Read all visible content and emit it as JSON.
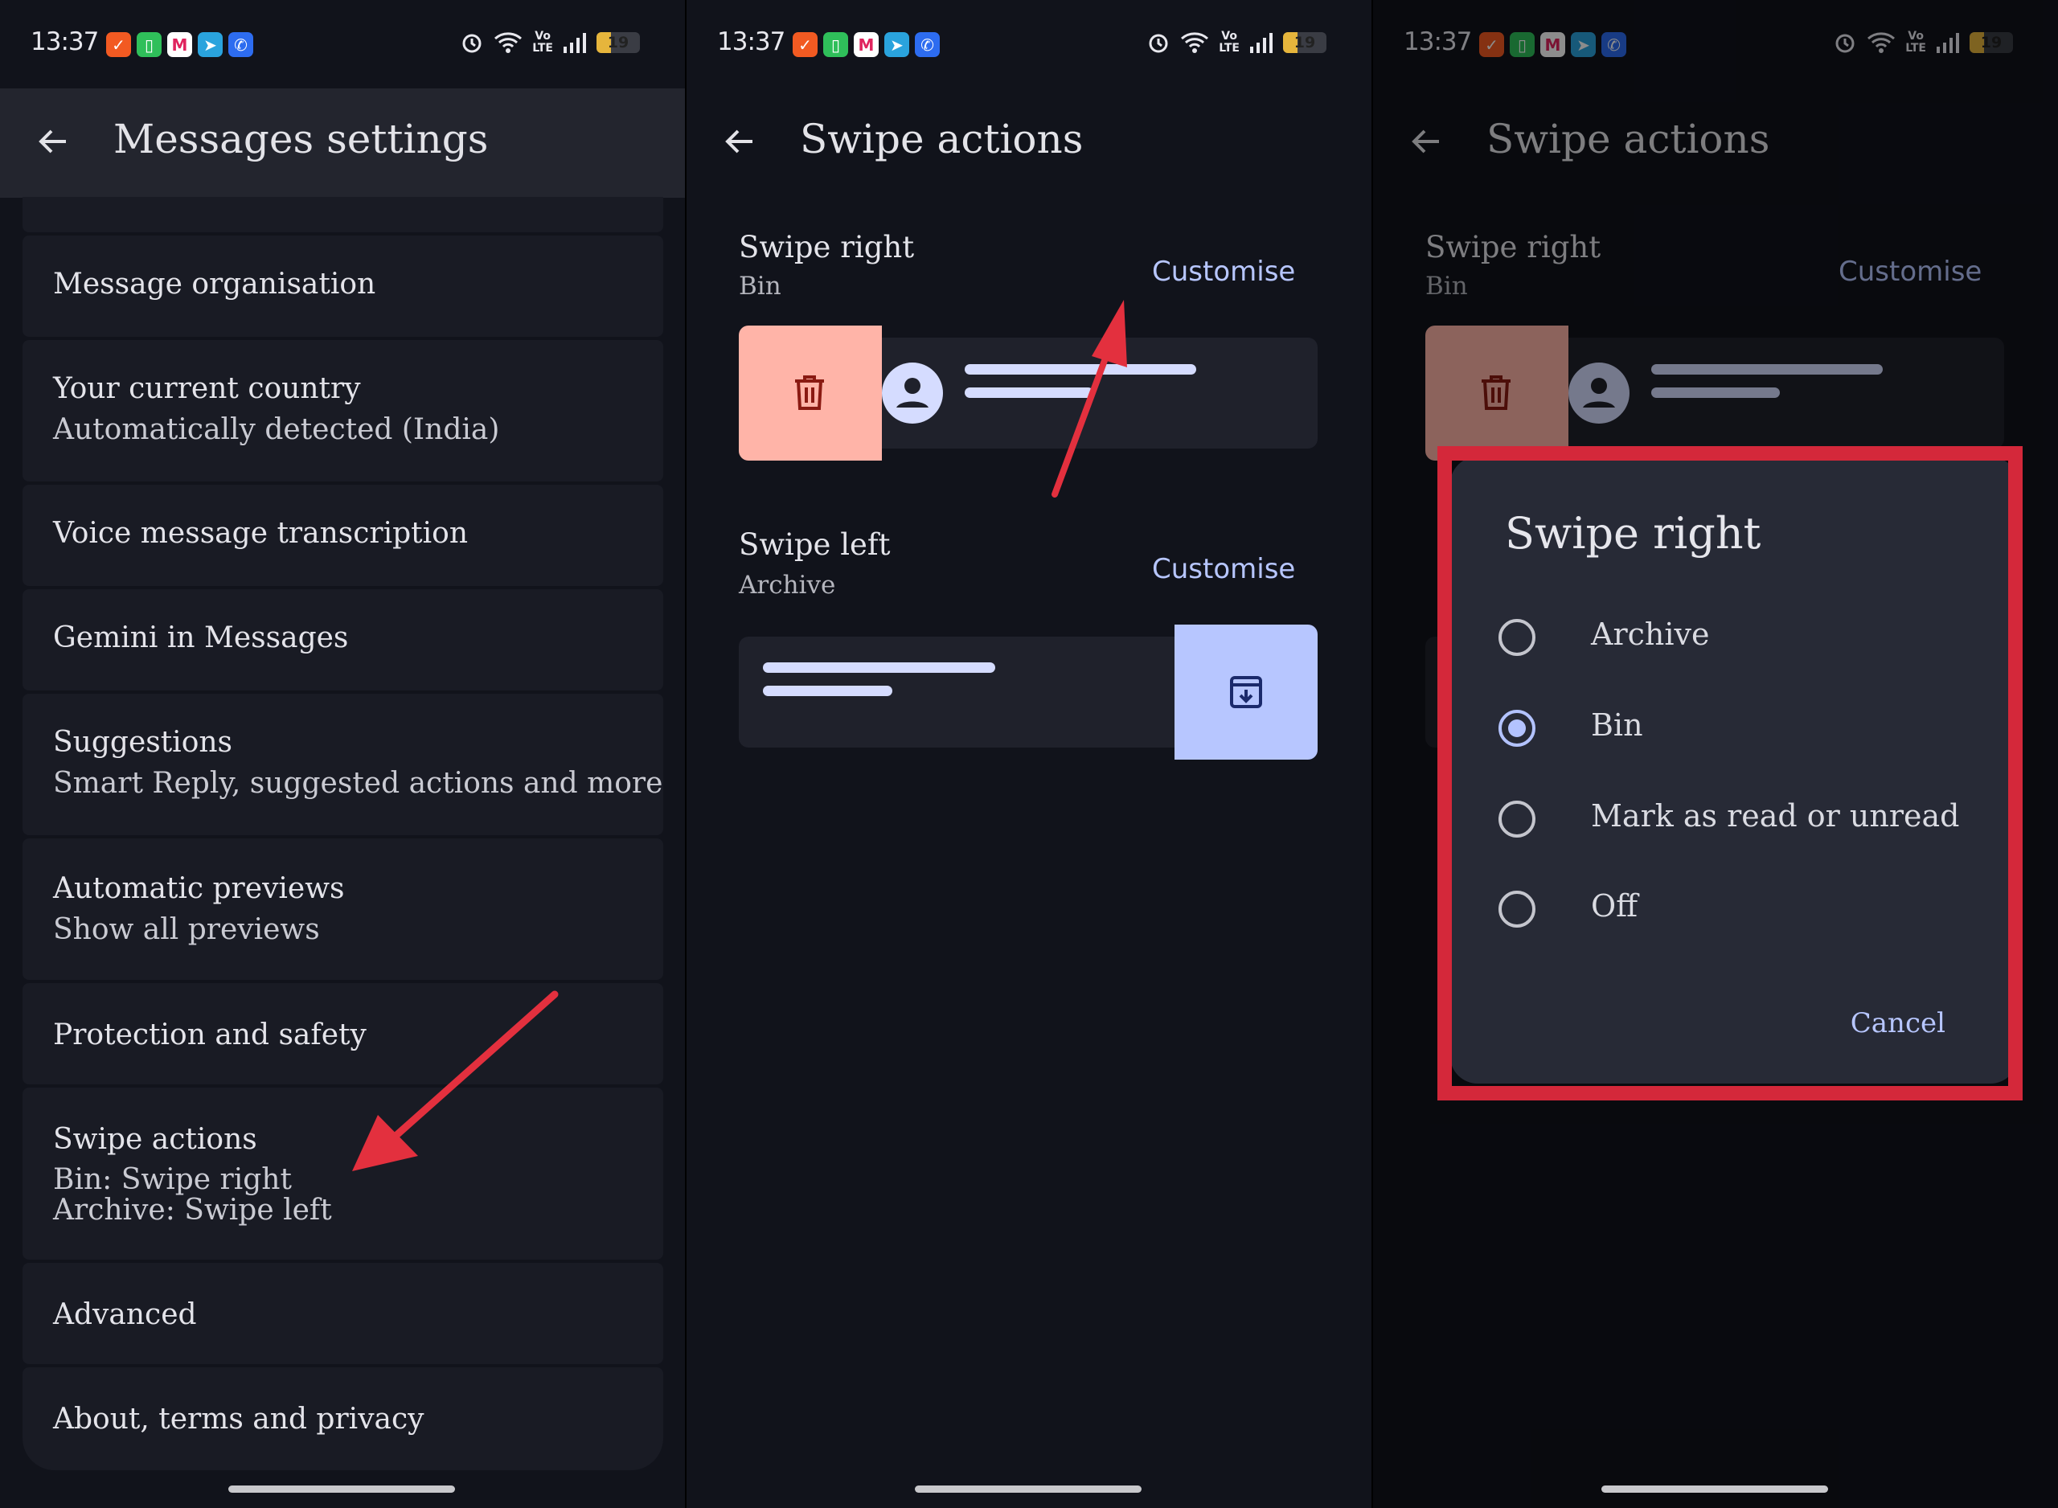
{
  "status": {
    "time": "13:37",
    "volte_top": "Vo",
    "volte_bottom": "LTE",
    "battery": "19",
    "battery_level_percent": 19,
    "notification_icons": [
      "check-icon",
      "phone-app-icon",
      "m-app-icon",
      "telegram-icon",
      "phone-call-icon"
    ],
    "system_icons": [
      "alarm-icon",
      "wifi-icon",
      "volte-icon",
      "signal-icon",
      "battery-icon"
    ]
  },
  "panel1": {
    "title": "Messages settings",
    "items": [
      {
        "title": "Message organisation",
        "subtitle": ""
      },
      {
        "title": "Your current country",
        "subtitle": "Automatically detected (India)"
      },
      {
        "title": "Voice message transcription",
        "subtitle": ""
      },
      {
        "title": "Gemini in Messages",
        "subtitle": ""
      },
      {
        "title": "Suggestions",
        "subtitle": "Smart Reply, suggested actions and more"
      },
      {
        "title": "Automatic previews",
        "subtitle": "Show all previews"
      },
      {
        "title": "Protection and safety",
        "subtitle": ""
      },
      {
        "title": "Swipe actions",
        "subtitle": "Bin: Swipe right",
        "subtitle2": "Archive: Swipe left"
      },
      {
        "title": "Advanced",
        "subtitle": ""
      },
      {
        "title": "About, terms and privacy",
        "subtitle": ""
      }
    ]
  },
  "panel2": {
    "title": "Swipe actions",
    "swipe_right": {
      "title": "Swipe right",
      "value": "Bin",
      "action": "Customise"
    },
    "swipe_left": {
      "title": "Swipe left",
      "value": "Archive",
      "action": "Customise"
    }
  },
  "panel3": {
    "title": "Swipe actions",
    "swipe_right": {
      "title": "Swipe right",
      "value": "Bin",
      "action": "Customise"
    },
    "dialog": {
      "title": "Swipe right",
      "options": [
        "Archive",
        "Bin",
        "Mark as read or unread",
        "Off"
      ],
      "selected": "Bin",
      "cancel": "Cancel"
    }
  },
  "colors": {
    "background": "#11131b",
    "accent": "#b7c6ff",
    "bin_color": "#ffb4a8",
    "archive_color": "#b7c6ff",
    "annotation_red": "#d4283a"
  }
}
